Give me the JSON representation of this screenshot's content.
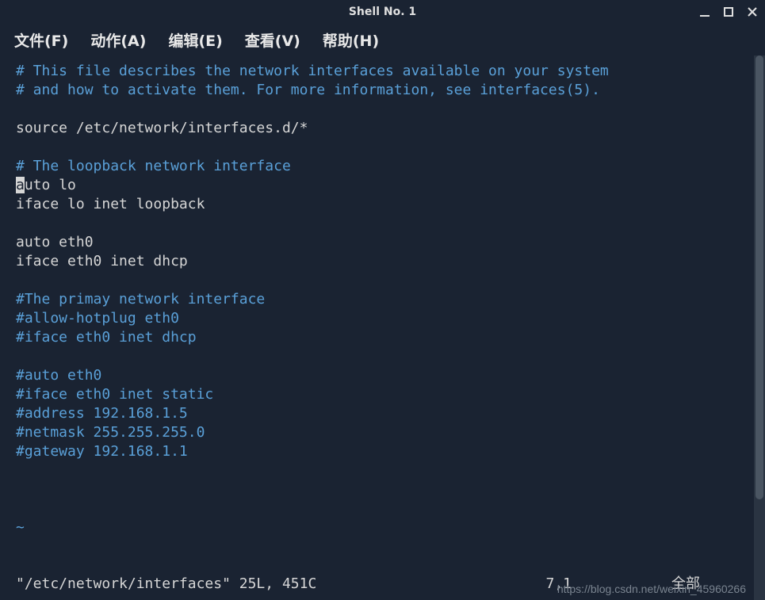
{
  "window": {
    "title": "Shell No. 1"
  },
  "menubar": {
    "file": "文件(F)",
    "actions": "动作(A)",
    "edit": "编辑(E)",
    "view": "查看(V)",
    "help": "帮助(H)"
  },
  "editor": {
    "lines": [
      {
        "type": "comment",
        "text": "# This file describes the network interfaces available on your system"
      },
      {
        "type": "comment",
        "text": "# and how to activate them. For more information, see interfaces(5)."
      },
      {
        "type": "blank",
        "text": ""
      },
      {
        "type": "normal",
        "text": "source /etc/network/interfaces.d/*"
      },
      {
        "type": "blank",
        "text": ""
      },
      {
        "type": "comment",
        "text": "# The loopback network interface"
      },
      {
        "type": "cursor-line",
        "cursor_char": "a",
        "rest": "uto lo"
      },
      {
        "type": "normal",
        "text": "iface lo inet loopback"
      },
      {
        "type": "blank",
        "text": ""
      },
      {
        "type": "normal",
        "text": "auto eth0"
      },
      {
        "type": "normal",
        "text": "iface eth0 inet dhcp"
      },
      {
        "type": "blank",
        "text": ""
      },
      {
        "type": "comment",
        "text": "#The primay network interface"
      },
      {
        "type": "comment",
        "text": "#allow-hotplug eth0"
      },
      {
        "type": "comment",
        "text": "#iface eth0 inet dhcp"
      },
      {
        "type": "blank",
        "text": ""
      },
      {
        "type": "comment",
        "text": "#auto eth0"
      },
      {
        "type": "comment",
        "text": "#iface eth0 inet static"
      },
      {
        "type": "comment",
        "text": "#address 192.168.1.5"
      },
      {
        "type": "comment",
        "text": "#netmask 255.255.255.0"
      },
      {
        "type": "comment",
        "text": "#gateway 192.168.1.1"
      }
    ],
    "tilde_marker": "~",
    "status": {
      "file": "\"/etc/network/interfaces\" 25L, 451C",
      "position": "7,1",
      "percent": "全部"
    }
  },
  "watermark": "https://blog.csdn.net/weixin_45960266"
}
